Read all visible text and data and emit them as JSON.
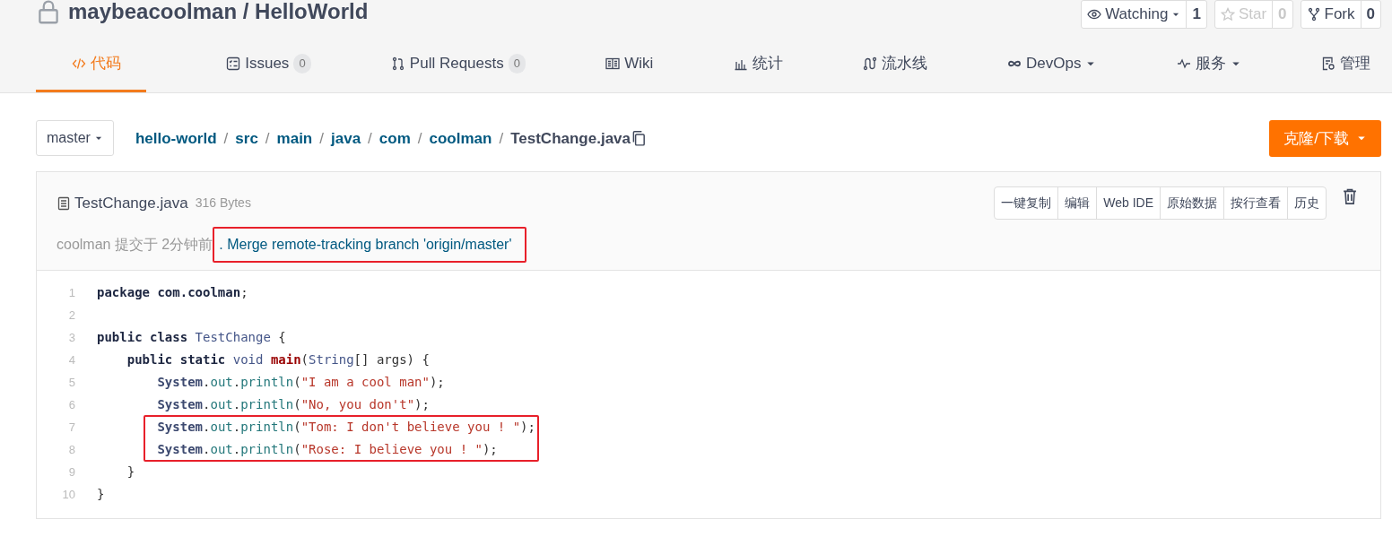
{
  "repo": {
    "owner": "maybeacoolman",
    "separator": "/",
    "name": "HelloWorld",
    "private": true
  },
  "repo_actions": [
    {
      "kind": "watch",
      "label": "Watching",
      "count": "1",
      "disabled": false
    },
    {
      "kind": "star",
      "label": "Star",
      "count": "0",
      "disabled": true
    },
    {
      "kind": "fork",
      "label": "Fork",
      "count": "0",
      "disabled": false
    }
  ],
  "tabs": [
    {
      "kind": "code",
      "label": "代码",
      "selected": true
    },
    {
      "kind": "issues",
      "label": "Issues",
      "count": "0",
      "selected": false
    },
    {
      "kind": "pulls",
      "label": "Pull Requests",
      "count": "0",
      "selected": false
    },
    {
      "kind": "wiki",
      "label": "Wiki",
      "selected": false
    },
    {
      "kind": "stats",
      "label": "统计",
      "selected": false
    },
    {
      "kind": "pipeline",
      "label": "流水线",
      "selected": false
    },
    {
      "kind": "devops",
      "label": "DevOps",
      "dropdown": true,
      "selected": false
    },
    {
      "kind": "service",
      "label": "服务",
      "dropdown": true,
      "selected": false
    },
    {
      "kind": "manage",
      "label": "管理",
      "selected": false
    }
  ],
  "branch": "master",
  "breadcrumb": [
    {
      "label": "hello-world",
      "link": true
    },
    {
      "separator": "/",
      "label": "src",
      "link": true
    },
    {
      "separator": "/",
      "label": "main",
      "link": true
    },
    {
      "separator": "/",
      "label": "java",
      "link": true
    },
    {
      "separator": "/",
      "label": "com",
      "link": true
    },
    {
      "separator": "/",
      "label": "coolman",
      "link": true
    },
    {
      "separator": "/",
      "label": "TestChange.java",
      "link": false
    }
  ],
  "clone_button": "克隆/下载",
  "file": {
    "name": "TestChange.java",
    "size": "316 Bytes",
    "toolbar": [
      "一键复制",
      "编辑",
      "Web IDE",
      "原始数据",
      "按行查看",
      "历史"
    ],
    "commit": {
      "author": "coolman",
      "info": "提交于 2分钟前",
      "message": ". Merge remote-tracking branch 'origin/master'",
      "highlighted": true
    }
  },
  "code": [
    {
      "number": "1",
      "tokens": [
        {
          "kind": "keyword",
          "text": "package "
        },
        {
          "kind": "keyword",
          "text": "com.coolman"
        },
        {
          "kind": "plain",
          "text": ";"
        }
      ]
    },
    {
      "number": "2"
    },
    {
      "number": "3",
      "tokens": [
        {
          "kind": "keyword",
          "text": "public class "
        },
        {
          "kind": "type",
          "text": "TestChange"
        },
        {
          "kind": "plain",
          "text": " {"
        }
      ]
    },
    {
      "number": "4",
      "tokens": [
        {
          "kind": "keyword",
          "text": "    public static "
        },
        {
          "kind": "type",
          "text": "void "
        },
        {
          "kind": "function",
          "text": "main"
        },
        {
          "kind": "plain",
          "text": "("
        },
        {
          "kind": "type",
          "text": "String"
        },
        {
          "kind": "plain",
          "text": "[] args) {"
        }
      ]
    },
    {
      "number": "5",
      "tokens": [
        {
          "kind": "class",
          "text": "        System"
        },
        {
          "kind": "plain",
          "text": "."
        },
        {
          "kind": "field",
          "text": "out"
        },
        {
          "kind": "plain",
          "text": "."
        },
        {
          "kind": "field",
          "text": "println"
        },
        {
          "kind": "plain",
          "text": "("
        },
        {
          "kind": "string",
          "text": "\"I am a cool man\""
        },
        {
          "kind": "plain",
          "text": ");"
        }
      ]
    },
    {
      "number": "6",
      "tokens": [
        {
          "kind": "class",
          "text": "        System"
        },
        {
          "kind": "plain",
          "text": "."
        },
        {
          "kind": "field",
          "text": "out"
        },
        {
          "kind": "plain",
          "text": "."
        },
        {
          "kind": "field",
          "text": "println"
        },
        {
          "kind": "plain",
          "text": "("
        },
        {
          "kind": "string",
          "text": "\"No, you don't\""
        },
        {
          "kind": "plain",
          "text": ");"
        }
      ]
    },
    {
      "number": "7",
      "highlighted": true,
      "tokens": [
        {
          "kind": "class",
          "text": "        System"
        },
        {
          "kind": "plain",
          "text": "."
        },
        {
          "kind": "field",
          "text": "out"
        },
        {
          "kind": "plain",
          "text": "."
        },
        {
          "kind": "field",
          "text": "println"
        },
        {
          "kind": "plain",
          "text": "("
        },
        {
          "kind": "string",
          "text": "\"Tom: I don't believe you ! \""
        },
        {
          "kind": "plain",
          "text": ");"
        }
      ]
    },
    {
      "number": "8",
      "highlighted": true,
      "tokens": [
        {
          "kind": "class",
          "text": "        System"
        },
        {
          "kind": "plain",
          "text": "."
        },
        {
          "kind": "field",
          "text": "out"
        },
        {
          "kind": "plain",
          "text": "."
        },
        {
          "kind": "field",
          "text": "println"
        },
        {
          "kind": "plain",
          "text": "("
        },
        {
          "kind": "string",
          "text": "\"Rose: I believe you ! \""
        },
        {
          "kind": "plain",
          "text": ");"
        }
      ]
    },
    {
      "number": "9",
      "tokens": [
        {
          "kind": "plain",
          "text": "    }"
        }
      ]
    },
    {
      "number": "10",
      "tokens": [
        {
          "kind": "plain",
          "text": "}"
        }
      ]
    }
  ]
}
